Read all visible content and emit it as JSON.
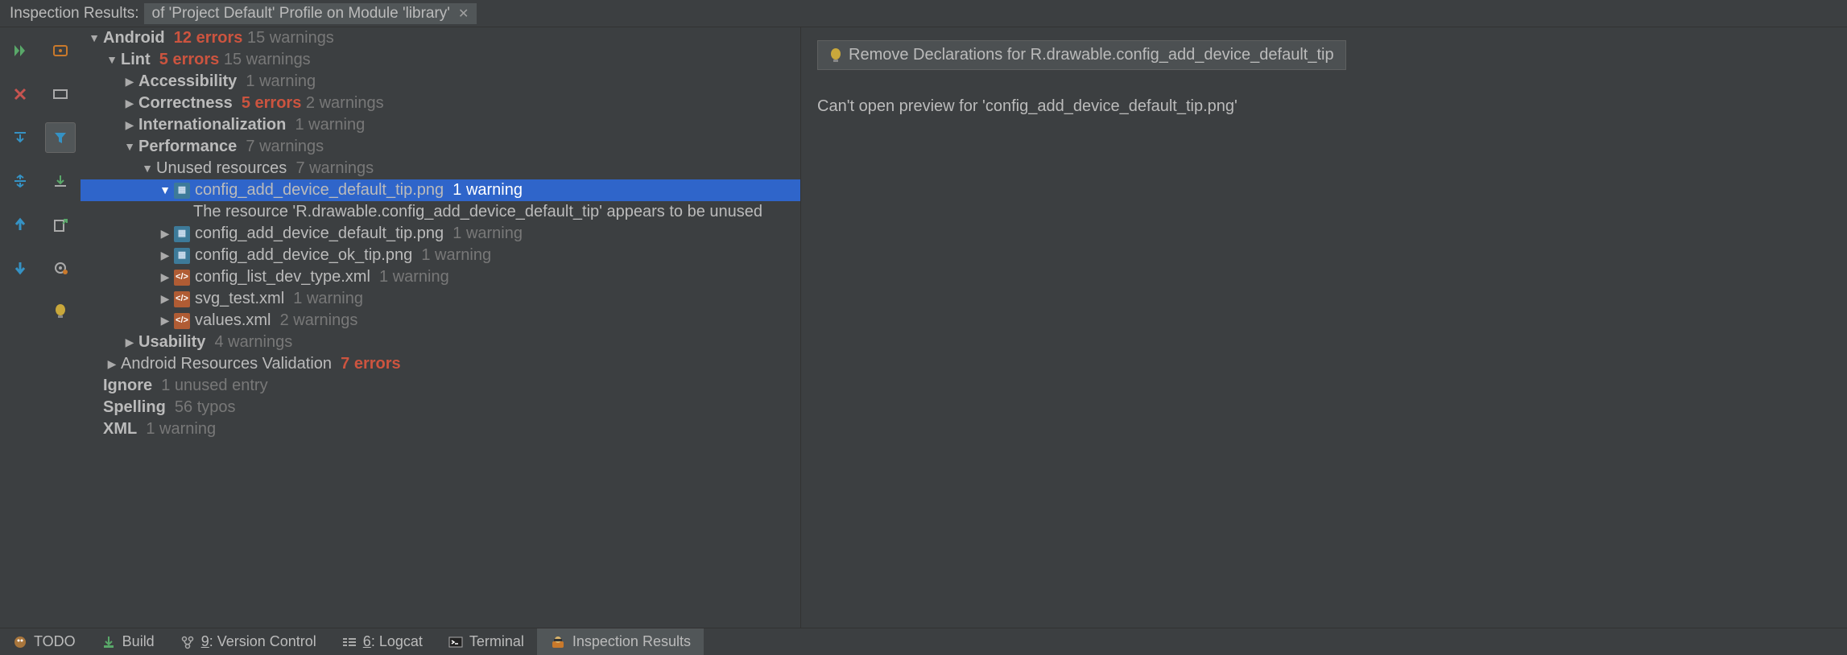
{
  "header": {
    "label": "Inspection Results:",
    "tab": "of 'Project Default' Profile on Module 'library'"
  },
  "detail": {
    "suggestion": "Remove Declarations for R.drawable.config_add_device_default_tip",
    "message": "Can't open preview for 'config_add_device_default_tip.png'"
  },
  "tree": {
    "android": {
      "label": "Android",
      "errors": "12 errors",
      "warn": "15 warnings"
    },
    "lint": {
      "label": "Lint",
      "errors": "5 errors",
      "warn": "15 warnings"
    },
    "accessibility": {
      "label": "Accessibility",
      "warn": "1 warning"
    },
    "correctness": {
      "label": "Correctness",
      "errors": "5 errors",
      "warn": "2 warnings"
    },
    "intl": {
      "label": "Internationalization",
      "warn": "1 warning"
    },
    "perf": {
      "label": "Performance",
      "warn": "7 warnings"
    },
    "unused": {
      "label": "Unused resources",
      "warn": "7 warnings"
    },
    "sel": {
      "file": "config_add_device_default_tip.png",
      "warn": "1 warning"
    },
    "selmsg": "The resource 'R.drawable.config_add_device_default_tip' appears to be unused",
    "f2": {
      "file": "config_add_device_default_tip.png",
      "warn": "1 warning"
    },
    "f3": {
      "file": "config_add_device_ok_tip.png",
      "warn": "1 warning"
    },
    "f4": {
      "file": "config_list_dev_type.xml",
      "warn": "1 warning"
    },
    "f5": {
      "file": "svg_test.xml",
      "warn": "1 warning"
    },
    "f6": {
      "file": "values.xml",
      "warn": "2 warnings"
    },
    "usability": {
      "label": "Usability",
      "warn": "4 warnings"
    },
    "arv": {
      "label": "Android Resources Validation",
      "errors": "7 errors"
    },
    "ignore": {
      "label": "Ignore",
      "warn": "1 unused entry"
    },
    "spelling": {
      "label": "Spelling",
      "warn": "56 typos"
    },
    "xml": {
      "label": "XML",
      "warn": "1 warning"
    }
  },
  "footer": {
    "todo": "TODO",
    "build": "Build",
    "vc_n": "9",
    "vc": ": Version Control",
    "lc_n": "6",
    "lc": ": Logcat",
    "term": "Terminal",
    "insp": "Inspection Results"
  }
}
